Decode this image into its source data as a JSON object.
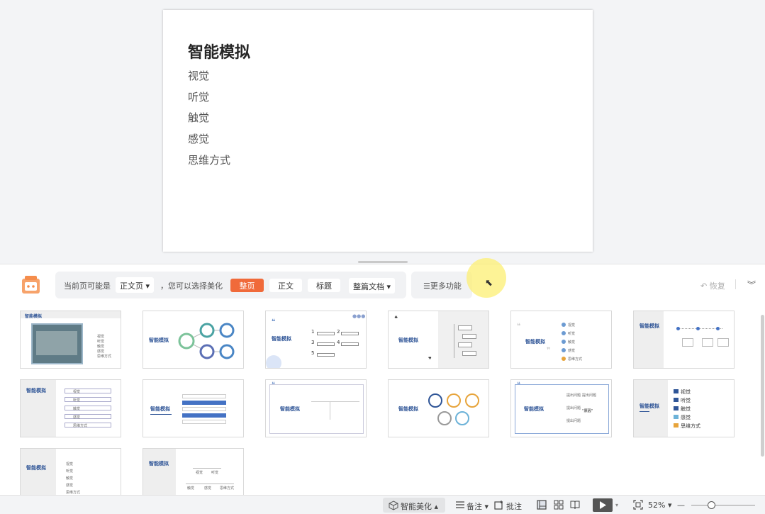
{
  "slide": {
    "title": "智能模拟",
    "lines": [
      "视觉",
      "听觉",
      "触觉",
      "感觉",
      "思维方式"
    ]
  },
  "panel": {
    "prefix": "当前页可能是",
    "page_type": "正文页 ▾",
    "middle": "，您可以选择美化",
    "tabs": [
      "整页",
      "正文",
      "标题"
    ],
    "scope": "整篇文档 ▾",
    "more": "☰更多功能",
    "restore": "↶ 恢复",
    "collapse": "︾"
  },
  "thumb_texts": {
    "title": "智能模拟",
    "items": [
      "视觉",
      "听觉",
      "触觉",
      "感觉",
      "思维方式"
    ],
    "mini_a": "提出问题",
    "mini_b": "\"原因\"",
    "nums": [
      "1",
      "2",
      "3",
      "4",
      "5"
    ]
  },
  "status": {
    "beautify": "智能美化 ▴",
    "notes": "备注 ▾",
    "comments": "批注",
    "zoom": "52% ▾",
    "zoom_minus": "—"
  },
  "colors": {
    "accent": "#f06a3a",
    "thumb_title": "#2f5597",
    "panel_bg": "#ffffff",
    "workspace_bg": "#f3f4f6"
  }
}
